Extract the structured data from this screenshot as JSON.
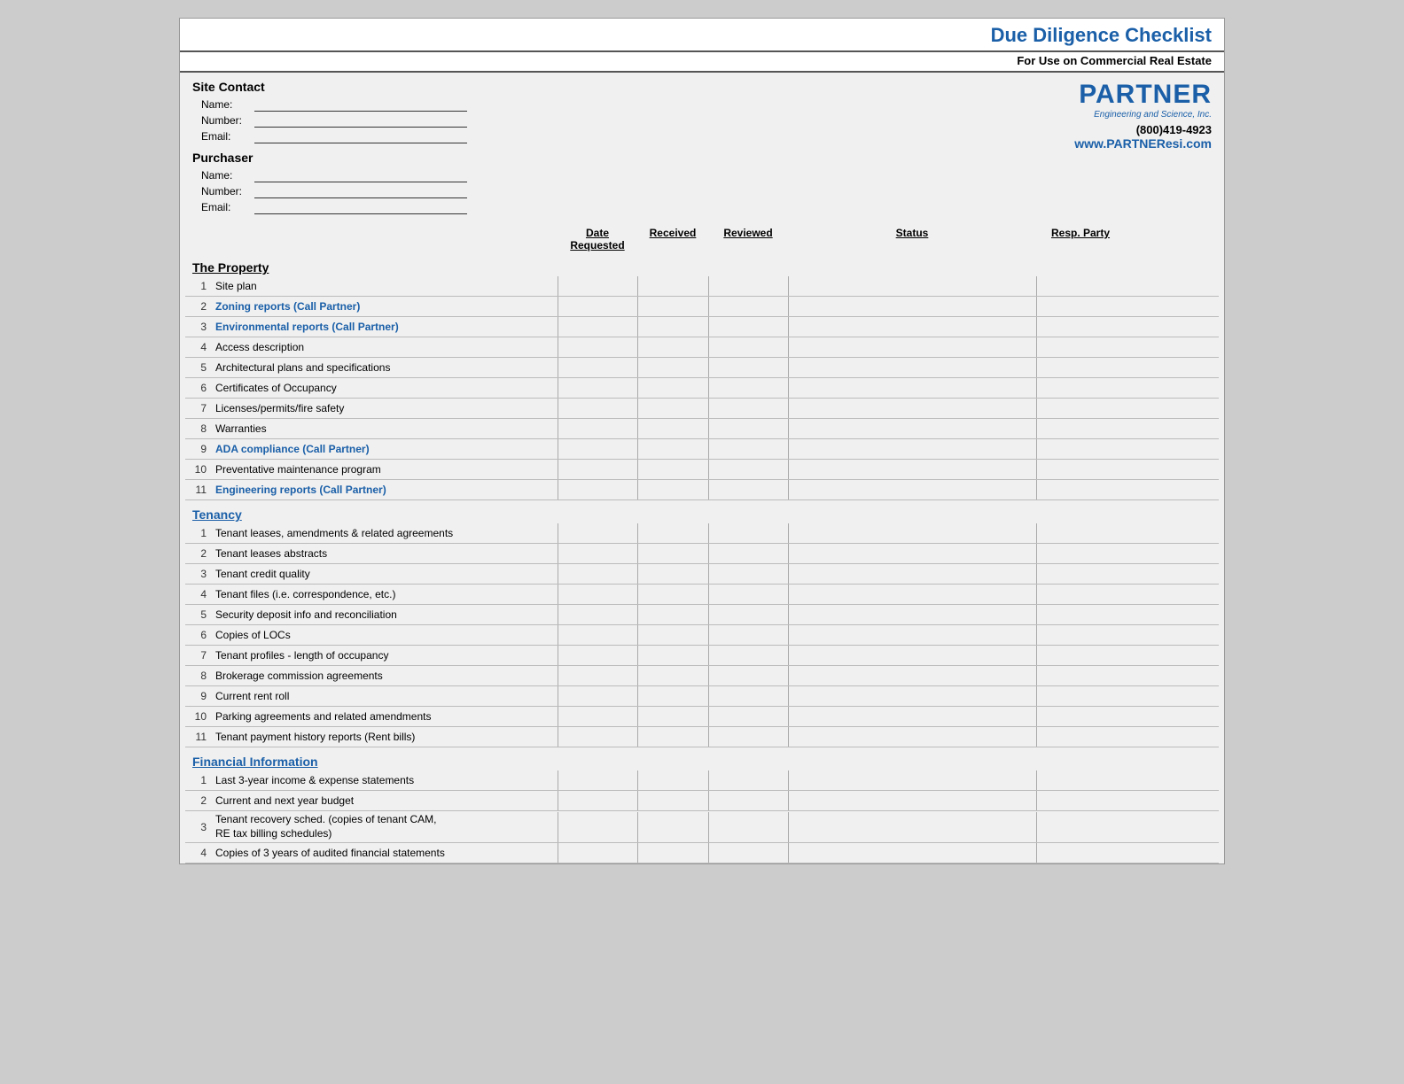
{
  "header": {
    "title": "Due Diligence Checklist",
    "subtitle": "For Use on Commercial Real Estate"
  },
  "logo": {
    "name": "PARTNER",
    "sub": "Engineering and Science, Inc.",
    "phone": "(800)419-4923",
    "website": "www.PARTNEResi.com"
  },
  "site_contact": {
    "label": "Site Contact",
    "name_label": "Name:",
    "number_label": "Number:",
    "email_label": "Email:"
  },
  "purchaser": {
    "label": "Purchaser",
    "name_label": "Name:",
    "number_label": "Number:",
    "email_label": "Email:"
  },
  "columns": {
    "date_requested": "Date Requested",
    "received": "Received",
    "reviewed": "Reviewed",
    "status": "Status",
    "resp_party": "Resp. Party"
  },
  "sections": [
    {
      "id": "the_property",
      "heading": "The Property",
      "heading_color": "black",
      "items": [
        {
          "num": 1,
          "label": "Site plan",
          "blue": false
        },
        {
          "num": 2,
          "label": "Zoning reports (Call Partner)",
          "blue": true
        },
        {
          "num": 3,
          "label": "Environmental reports (Call Partner)",
          "blue": true
        },
        {
          "num": 4,
          "label": "Access description",
          "blue": false
        },
        {
          "num": 5,
          "label": "Architectural plans and specifications",
          "blue": false
        },
        {
          "num": 6,
          "label": "Certificates of Occupancy",
          "blue": false
        },
        {
          "num": 7,
          "label": "Licenses/permits/fire safety",
          "blue": false
        },
        {
          "num": 8,
          "label": "Warranties",
          "blue": false
        },
        {
          "num": 9,
          "label": "ADA compliance (Call Partner)",
          "blue": true
        },
        {
          "num": 10,
          "label": "Preventative maintenance program",
          "blue": false
        },
        {
          "num": 11,
          "label": "Engineering reports (Call Partner)",
          "blue": true
        }
      ]
    },
    {
      "id": "tenancy",
      "heading": "Tenancy",
      "heading_color": "blue",
      "items": [
        {
          "num": 1,
          "label": "Tenant leases, amendments & related agreements",
          "blue": false
        },
        {
          "num": 2,
          "label": "Tenant leases abstracts",
          "blue": false
        },
        {
          "num": 3,
          "label": "Tenant credit quality",
          "blue": false
        },
        {
          "num": 4,
          "label": "Tenant files (i.e. correspondence, etc.)",
          "blue": false
        },
        {
          "num": 5,
          "label": "Security deposit info and reconciliation",
          "blue": false
        },
        {
          "num": 6,
          "label": "Copies of LOCs",
          "blue": false
        },
        {
          "num": 7,
          "label": "Tenant profiles - length of occupancy",
          "blue": false
        },
        {
          "num": 8,
          "label": "Brokerage commission agreements",
          "blue": false
        },
        {
          "num": 9,
          "label": "Current rent roll",
          "blue": false
        },
        {
          "num": 10,
          "label": "Parking agreements and related amendments",
          "blue": false
        },
        {
          "num": 11,
          "label": "Tenant payment history reports (Rent bills)",
          "blue": false
        }
      ]
    },
    {
      "id": "financial_information",
      "heading": "Financial Information",
      "heading_color": "blue",
      "items": [
        {
          "num": 1,
          "label": "Last 3-year income & expense statements",
          "blue": false
        },
        {
          "num": 2,
          "label": "Current and next year budget",
          "blue": false
        },
        {
          "num": 3,
          "label": "Tenant recovery sched. (copies of tenant CAM,\nRE tax billing schedules)",
          "blue": false,
          "tall": true
        },
        {
          "num": 4,
          "label": "Copies of 3 years of audited financial statements",
          "blue": false
        }
      ]
    }
  ]
}
